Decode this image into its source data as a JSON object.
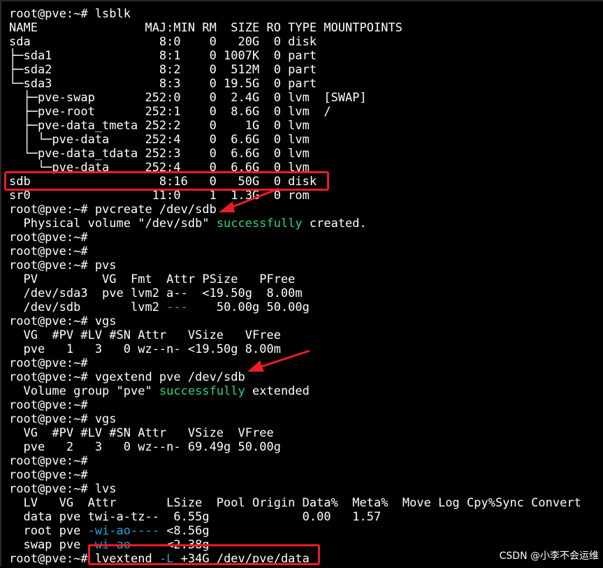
{
  "terminal": {
    "lines": [
      [
        "root@pve:~# lsblk"
      ],
      [
        "NAME               MAJ:MIN RM  SIZE RO TYPE MOUNTPOINTS"
      ],
      [
        "sda                  8:0    0   20G  0 disk"
      ],
      [
        "├─sda1               8:1    0 1007K  0 part"
      ],
      [
        "├─sda2               8:2    0  512M  0 part"
      ],
      [
        "└─sda3               8:3    0 19.5G  0 part"
      ],
      [
        "  ├─pve-swap       252:0    0  2.4G  0 lvm  [SWAP]"
      ],
      [
        "  ├─pve-root       252:1    0  8.6G  0 lvm  /"
      ],
      [
        "  ├─pve-data_tmeta 252:2    0    1G  0 lvm"
      ],
      [
        "  │ └─pve-data     252:4    0  6.6G  0 lvm"
      ],
      [
        "  └─pve-data_tdata 252:3    0  6.6G  0 lvm"
      ],
      [
        "    └─pve-data     252:4    0  6.6G  0 lvm"
      ],
      [
        "sdb                  8:16   0   50G  0 disk"
      ],
      [
        "sr0                 11:0    1  1.3G  0 rom"
      ],
      [
        "root@pve:~# pvcreate /dev/sdb"
      ],
      [
        "  Physical volume \"/dev/sdb\" ",
        "successfully",
        " created."
      ],
      [
        "root@pve:~#"
      ],
      [
        "root@pve:~#"
      ],
      [
        "root@pve:~# pvs"
      ],
      [
        "  PV         VG  Fmt  Attr PSize   PFree"
      ],
      [
        "  /dev/sda3  pve lvm2 a--  <19.50g  8.00m"
      ],
      [
        "  /dev/sdb       lvm2 ",
        "---",
        "    50.00g 50.00g"
      ],
      [
        "root@pve:~# vgs"
      ],
      [
        "  VG  #PV #LV #SN Attr   VSize   VFree"
      ],
      [
        "  pve   1   3   0 wz--n- <19.50g 8.00m"
      ],
      [
        "root@pve:~#"
      ],
      [
        "root@pve:~# vgextend pve /dev/sdb"
      ],
      [
        "  Volume group \"pve\" ",
        "successfully",
        " extended"
      ],
      [
        "root@pve:~#"
      ],
      [
        "root@pve:~# vgs"
      ],
      [
        "  VG  #PV #LV #SN Attr   VSize  VFree"
      ],
      [
        "  pve   2   3   0 wz--n- 69.49g 50.00g"
      ],
      [
        "root@pve:~#"
      ],
      [
        "root@pve:~#"
      ],
      [
        "root@pve:~# lvs"
      ],
      [
        "  LV   VG  Attr       LSize  Pool Origin Data%  Meta%  Move Log Cpy%Sync Convert"
      ],
      [
        "  data pve twi-a-tz--  6.55g             0.00   1.57"
      ],
      [
        "  root pve ",
        "-wi-ao----",
        " <8.56g"
      ],
      [
        "  swap pve ",
        "-wi-ao----",
        " <2.38g"
      ],
      [
        "root@pve:~# lvextend ",
        "-L",
        " +34G /dev/pve/data"
      ]
    ],
    "highlight_colors": [
      "green",
      "blue"
    ]
  },
  "annotations": {
    "box_color": "#ee1c24",
    "arrow_color": "#ee1c24"
  },
  "watermark": "CSDN @小李不会运维"
}
